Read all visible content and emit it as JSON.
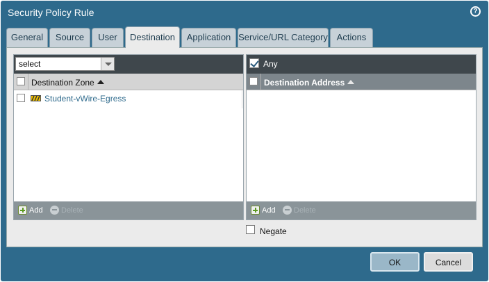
{
  "dialog": {
    "title": "Security Policy Rule",
    "help_icon": "help-icon"
  },
  "tabs": [
    {
      "label": "General"
    },
    {
      "label": "Source"
    },
    {
      "label": "User"
    },
    {
      "label": "Destination",
      "active": true
    },
    {
      "label": "Application"
    },
    {
      "label": "Service/URL Category"
    },
    {
      "label": "Actions"
    }
  ],
  "zone_panel": {
    "select_value": "select",
    "column_header": "Destination Zone",
    "rows": [
      {
        "label": "Student-vWire-Egress",
        "icon": "zone-icon",
        "checked": false
      }
    ],
    "add_label": "Add",
    "delete_label": "Delete"
  },
  "address_panel": {
    "any_label": "Any",
    "any_checked": true,
    "column_header": "Destination Address",
    "add_label": "Add",
    "delete_label": "Delete"
  },
  "negate": {
    "label": "Negate",
    "checked": false
  },
  "buttons": {
    "ok": "OK",
    "cancel": "Cancel"
  },
  "colors": {
    "title_bar": "#2e6a8c",
    "link": "#2e6a8c",
    "toolbar": "#8a9499"
  }
}
